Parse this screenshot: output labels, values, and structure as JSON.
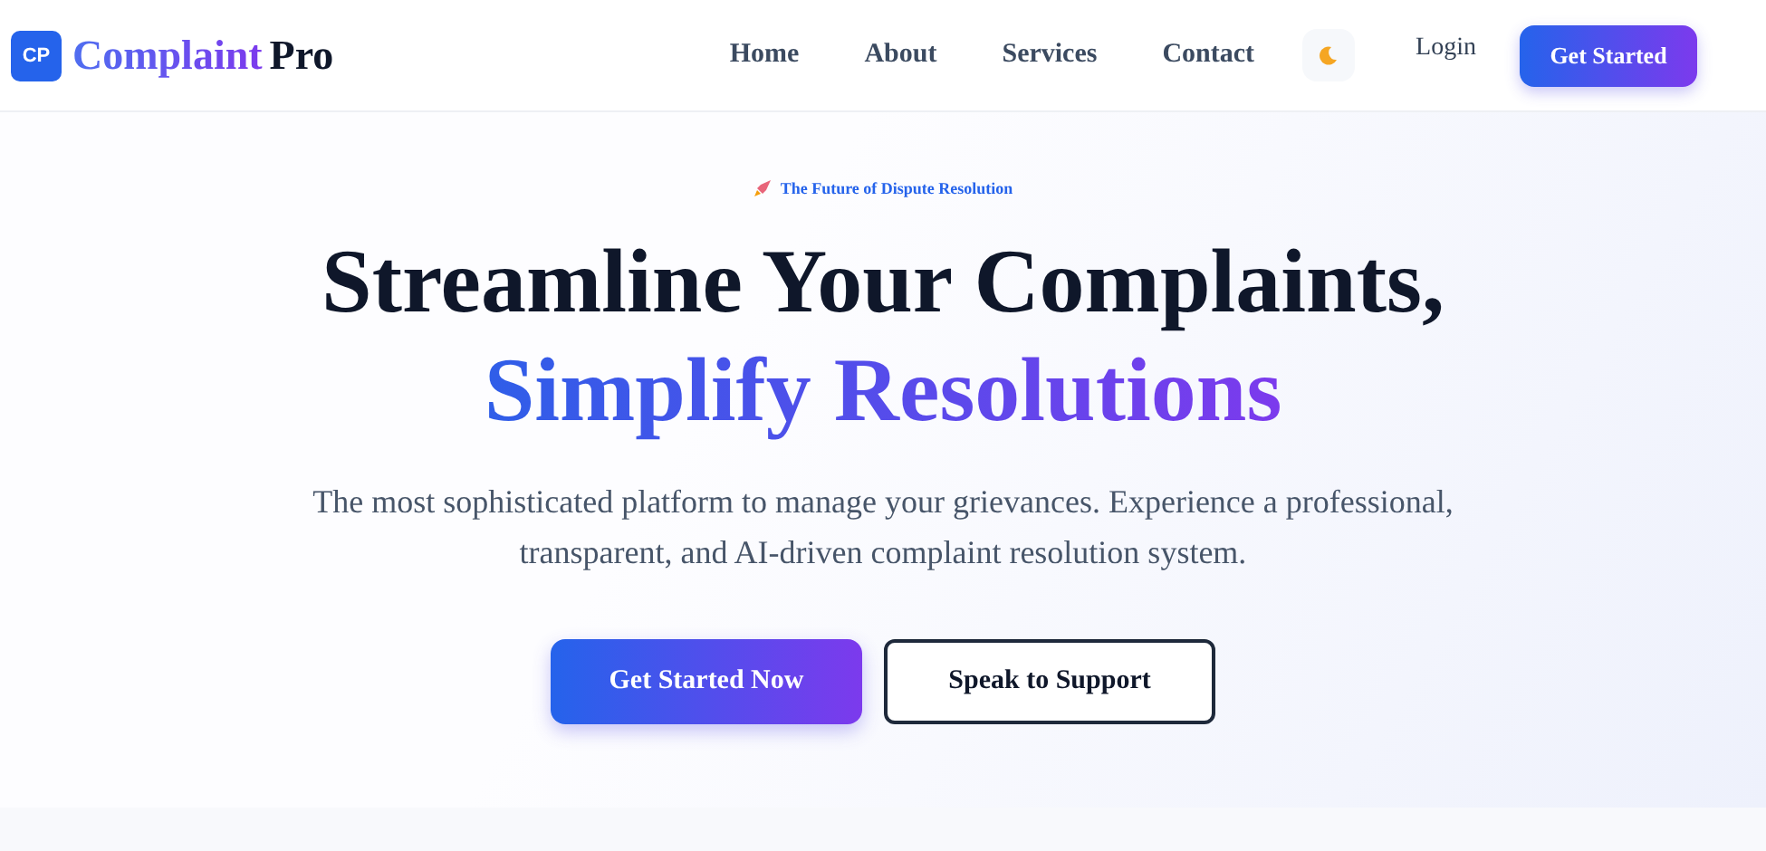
{
  "brand": {
    "badge": "CP",
    "name": "Complaint",
    "suffix": "Pro"
  },
  "nav": [
    "Home",
    "About",
    "Services",
    "Contact"
  ],
  "login": "Login",
  "cta": "Get Started",
  "hero": {
    "tagline": "The Future of Dispute Resolution",
    "title_line1": "Streamline Your Complaints,",
    "title_line2": "Simplify Resolutions",
    "description_line1": "The most sophisticated platform to manage your grievances. Experience a professional,",
    "description_line2": "transparent, and AI-driven complaint resolution system.",
    "primary_button": "Get Started Now",
    "secondary_button": "Speak to Support"
  }
}
